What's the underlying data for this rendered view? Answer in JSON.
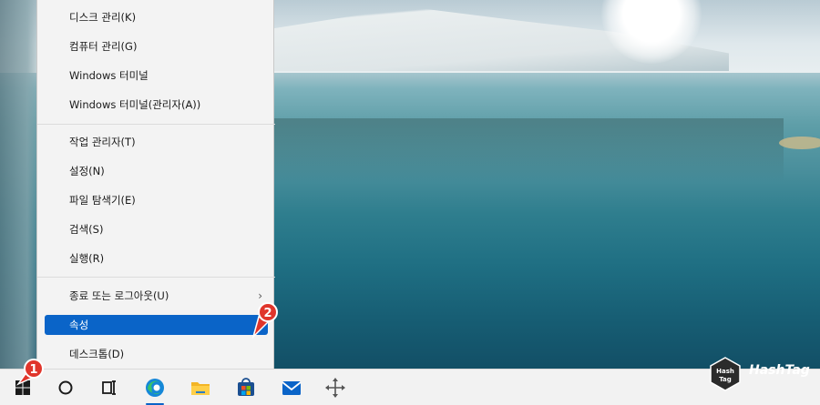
{
  "menu": {
    "items": [
      {
        "label": "디스크 관리(K)"
      },
      {
        "label": "컴퓨터 관리(G)"
      },
      {
        "label": "Windows 터미널"
      },
      {
        "label": "Windows 터미널(관리자(A))"
      },
      {
        "label": "작업 관리자(T)"
      },
      {
        "label": "설정(N)"
      },
      {
        "label": "파일 탐색기(E)"
      },
      {
        "label": "검색(S)"
      },
      {
        "label": "실행(R)"
      },
      {
        "label": "종료 또는 로그아웃(U)",
        "has_submenu": true
      },
      {
        "label": "속성",
        "selected": true
      },
      {
        "label": "데스크톱(D)"
      }
    ]
  },
  "badges": {
    "start": "1",
    "properties": "2"
  },
  "taskbar": {
    "icons": [
      "start-icon",
      "search-circle-icon",
      "task-view-icon",
      "edge-icon",
      "file-explorer-icon",
      "store-icon",
      "mail-icon",
      "move-icon"
    ]
  },
  "watermark": {
    "text": "HashTag",
    "logo_text": "Hash Tag"
  },
  "colors": {
    "selected": "#0a64c8",
    "badge": "#e0352b",
    "menu_bg": "#f3f3f3",
    "taskbar_bg": "#f2f2f2"
  }
}
